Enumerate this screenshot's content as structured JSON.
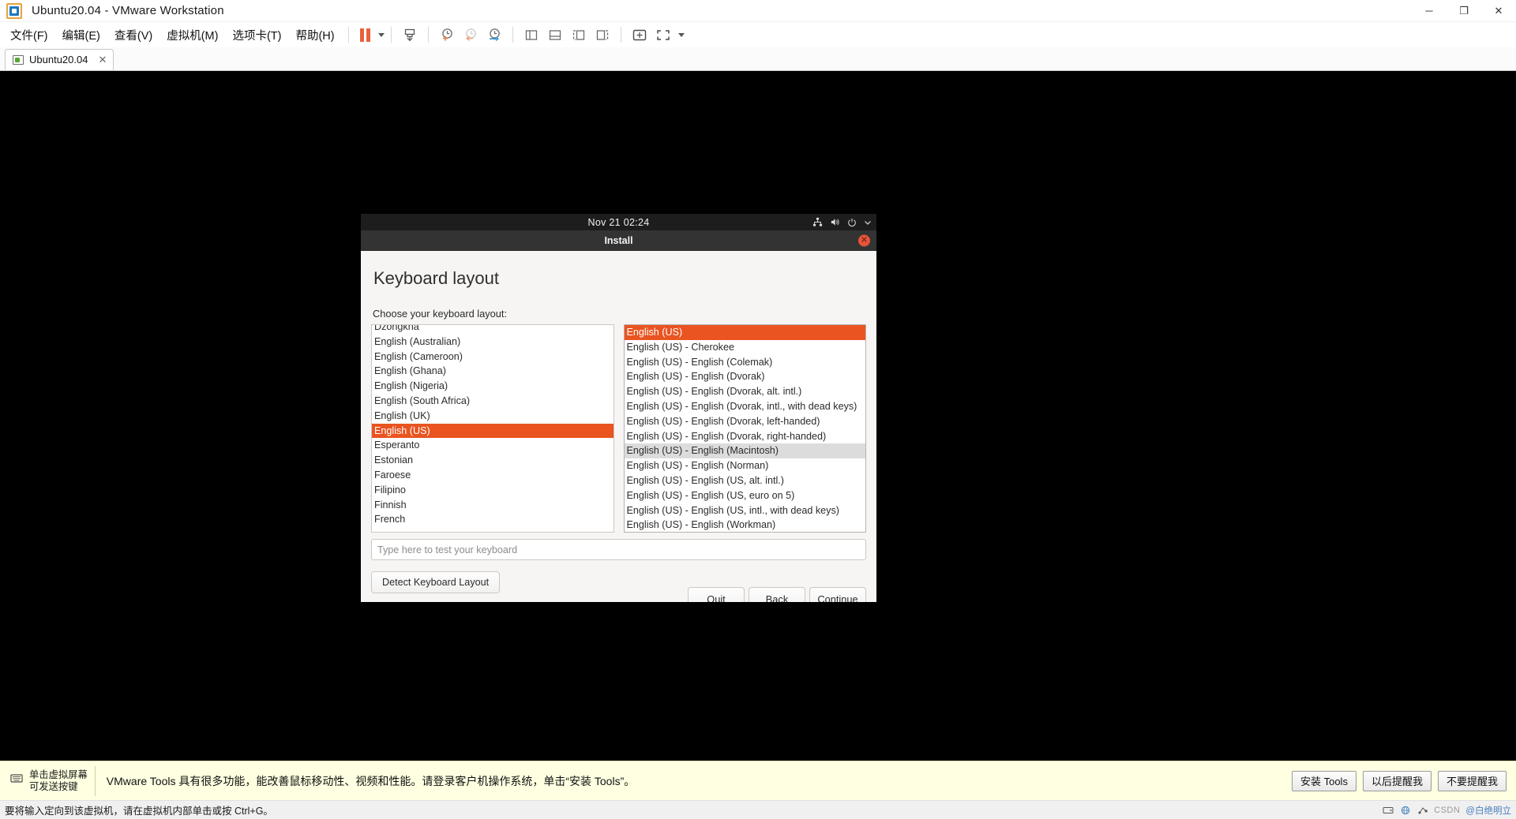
{
  "window": {
    "title": "Ubuntu20.04 - VMware Workstation",
    "logo_icon": "vmware-logo-icon",
    "minimize_label": "─",
    "maximize_label": "❐",
    "close_label": "✕"
  },
  "menubar": {
    "items": [
      {
        "label": "文件(F)",
        "name": "menu-file"
      },
      {
        "label": "编辑(E)",
        "name": "menu-edit"
      },
      {
        "label": "查看(V)",
        "name": "menu-view"
      },
      {
        "label": "虚拟机(M)",
        "name": "menu-vm"
      },
      {
        "label": "选项卡(T)",
        "name": "menu-tabs"
      },
      {
        "label": "帮助(H)",
        "name": "menu-help"
      }
    ],
    "toolbar_icons": [
      "pause-button",
      "dropdown-caret",
      "send-ctrl-alt-del-icon",
      "snapshot-take-icon",
      "snapshot-revert-icon",
      "snapshot-manager-icon",
      "show-library-icon",
      "show-thumbnail-bar-icon",
      "show-console-view-icon",
      "hide-console-view-icon",
      "unity-mode-icon",
      "fullscreen-icon"
    ]
  },
  "tabbar": {
    "tabs": [
      {
        "label": "Ubuntu20.04",
        "icon": "vm-thumbnail-icon",
        "close": "✕"
      }
    ]
  },
  "guest": {
    "topbar": {
      "clock": "Nov 21  02:24",
      "tray_icons": [
        "network-icon",
        "volume-icon",
        "power-icon",
        "chevron-down-icon"
      ]
    },
    "installer": {
      "window_title": "Install",
      "close_label": "✕",
      "heading": "Keyboard layout",
      "prompt": "Choose your keyboard layout:",
      "left_list": [
        {
          "label": "Dzongkha",
          "state": "clipped"
        },
        {
          "label": "English (Australian)",
          "state": "normal"
        },
        {
          "label": "English (Cameroon)",
          "state": "normal"
        },
        {
          "label": "English (Ghana)",
          "state": "normal"
        },
        {
          "label": "English (Nigeria)",
          "state": "normal"
        },
        {
          "label": "English (South Africa)",
          "state": "normal"
        },
        {
          "label": "English (UK)",
          "state": "normal"
        },
        {
          "label": "English (US)",
          "state": "selected"
        },
        {
          "label": "Esperanto",
          "state": "normal"
        },
        {
          "label": "Estonian",
          "state": "normal"
        },
        {
          "label": "Faroese",
          "state": "normal"
        },
        {
          "label": "Filipino",
          "state": "normal"
        },
        {
          "label": "Finnish",
          "state": "normal"
        },
        {
          "label": "French",
          "state": "normal"
        }
      ],
      "right_list": [
        {
          "label": "English (US)",
          "state": "selected"
        },
        {
          "label": "English (US) - Cherokee",
          "state": "normal"
        },
        {
          "label": "English (US) - English (Colemak)",
          "state": "normal"
        },
        {
          "label": "English (US) - English (Dvorak)",
          "state": "normal"
        },
        {
          "label": "English (US) - English (Dvorak, alt. intl.)",
          "state": "normal"
        },
        {
          "label": "English (US) - English (Dvorak, intl., with dead keys)",
          "state": "normal"
        },
        {
          "label": "English (US) - English (Dvorak, left-handed)",
          "state": "normal"
        },
        {
          "label": "English (US) - English (Dvorak, right-handed)",
          "state": "normal"
        },
        {
          "label": "English (US) - English (Macintosh)",
          "state": "hover"
        },
        {
          "label": "English (US) - English (Norman)",
          "state": "normal"
        },
        {
          "label": "English (US) - English (US, alt. intl.)",
          "state": "normal"
        },
        {
          "label": "English (US) - English (US, euro on 5)",
          "state": "normal"
        },
        {
          "label": "English (US) - English (US, intl., with dead keys)",
          "state": "normal"
        },
        {
          "label": "English (US) - English (Workman)",
          "state": "clipped"
        }
      ],
      "test_placeholder": "Type here to test your keyboard",
      "detect_button": "Detect Keyboard Layout",
      "nav_buttons": [
        {
          "label": "Quit",
          "name": "quit-button"
        },
        {
          "label": "Back",
          "name": "back-button"
        },
        {
          "label": "Continue",
          "name": "continue-button"
        }
      ]
    }
  },
  "notification": {
    "hint_icon": "keyboard-icon",
    "hint_line1": "单击虚拟屏幕",
    "hint_line2": "可发送按键",
    "message": "VMware Tools 具有很多功能，能改善鼠标移动性、视频和性能。请登录客户机操作系统，单击“安装 Tools”。",
    "buttons": [
      {
        "label": "安装 Tools",
        "name": "install-tools-button"
      },
      {
        "label": "以后提醒我",
        "name": "remind-me-later-button"
      },
      {
        "label": "不要提醒我",
        "name": "never-remind-button"
      }
    ]
  },
  "statusbar": {
    "message": "要将输入定向到该虚拟机，请在虚拟机内部单击或按 Ctrl+G。",
    "device_icons": [
      "harddisk-icon",
      "network-icon",
      "usb-icon"
    ],
    "watermark_csdn": "CSDN",
    "watermark_user": "@白绝明立"
  },
  "colors": {
    "ubuntu_accent": "#e95420",
    "vmware_orange": "#e8613c",
    "notif_bg": "#ffffe1",
    "gnome_topbar": "#1d1d1d",
    "installer_titlebar": "#333333",
    "installer_bg": "#f6f5f4"
  }
}
